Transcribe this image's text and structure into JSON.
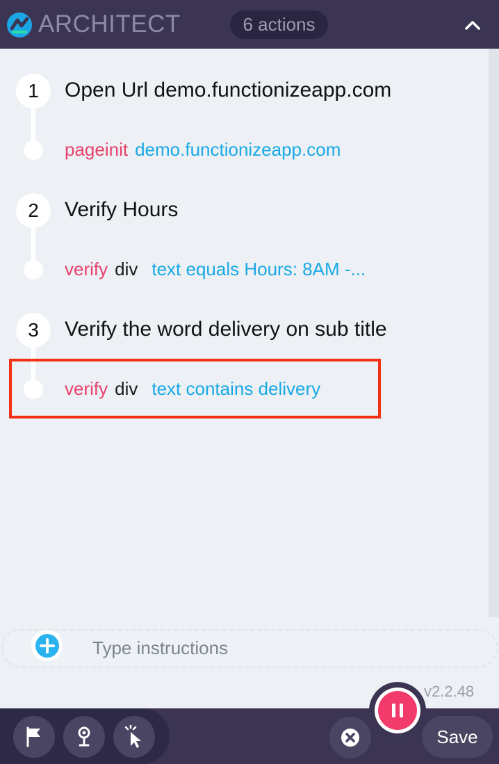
{
  "header": {
    "brand": "ARCHITECT",
    "actions_count": "6 actions"
  },
  "steps": [
    {
      "number": "1",
      "title": "Open Url demo.functionizeapp.com",
      "action": {
        "keyword": "pageinit",
        "target": "",
        "value": "demo.functionizeapp.com"
      }
    },
    {
      "number": "2",
      "title": "Verify Hours",
      "action": {
        "keyword": "verify",
        "target": "div",
        "value": "text equals Hours: 8AM -..."
      }
    },
    {
      "number": "3",
      "title": "Verify the word delivery on sub title",
      "action": {
        "keyword": "verify",
        "target": "div",
        "value": "text contains delivery"
      }
    }
  ],
  "instruction": {
    "placeholder": "Type instructions",
    "value": ""
  },
  "version": "v2.2.48",
  "footer": {
    "save_label": "Save"
  },
  "colors": {
    "header_bg": "#3b3553",
    "keyword": "#e8416b",
    "value": "#19a9e5",
    "highlight": "#f23015",
    "pause": "#f23b6a"
  },
  "icons": {
    "logo": "architect-logo-icon",
    "collapse": "chevron-up-icon",
    "add": "plus-circle-icon",
    "flag": "flag-icon",
    "waypoint": "pin-icon",
    "pointer": "pointer-click-icon",
    "pause": "pause-icon",
    "cancel": "close-circle-icon"
  }
}
